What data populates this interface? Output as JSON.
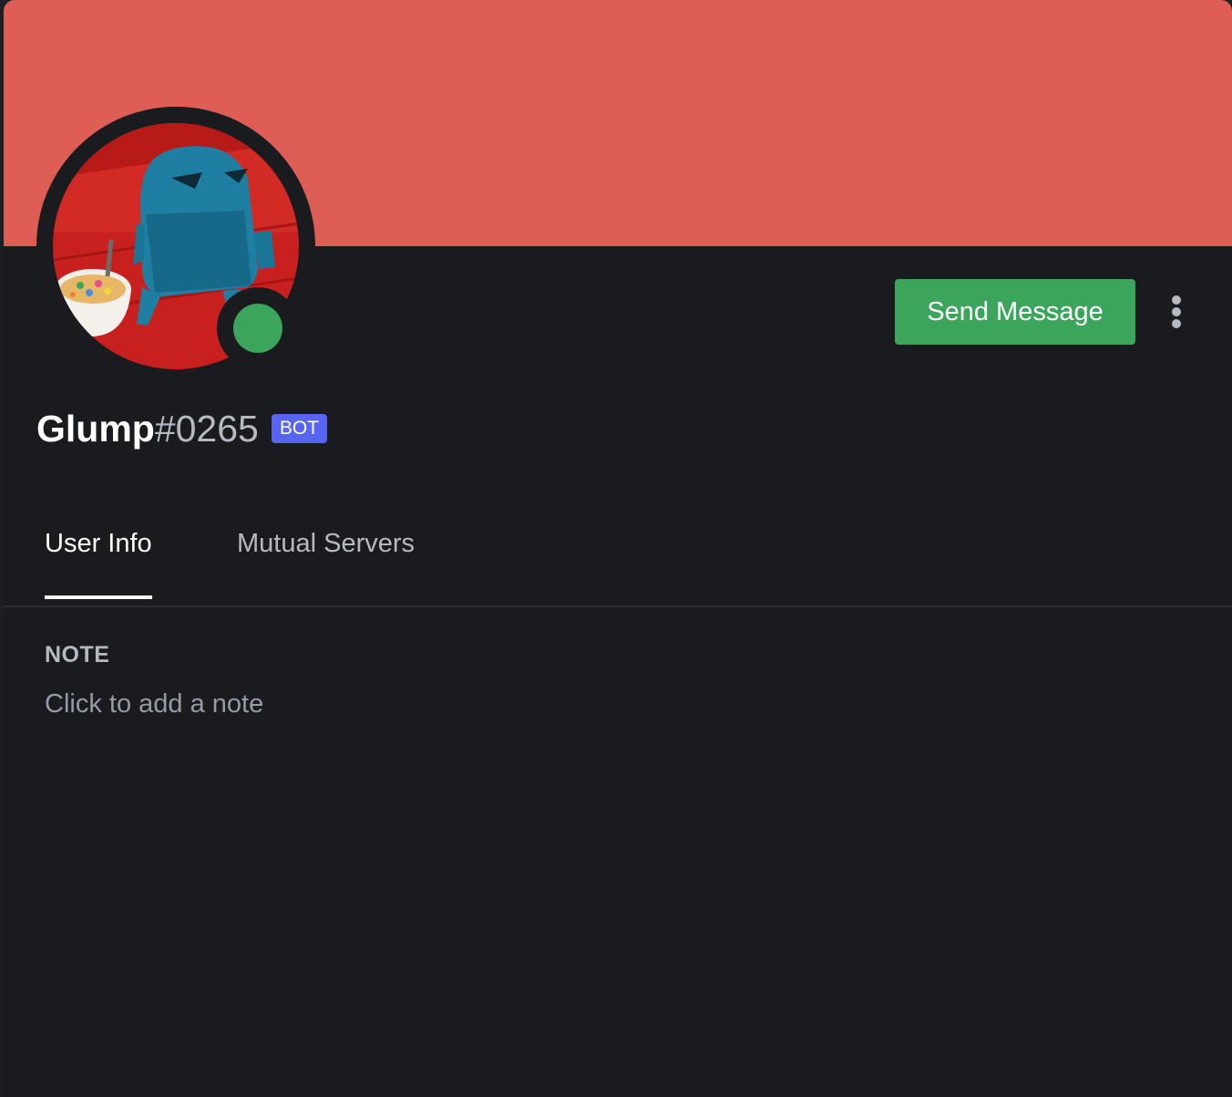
{
  "profile": {
    "username": "Glump",
    "discriminator": "#0265",
    "bot_tag": "BOT",
    "status": "online",
    "banner_color": "#de5e55",
    "status_color": "#3ba55c"
  },
  "actions": {
    "send_message_label": "Send Message",
    "more_icon": "more-vertical-icon"
  },
  "tabs": [
    {
      "label": "User Info",
      "active": true
    },
    {
      "label": "Mutual Servers",
      "active": false
    }
  ],
  "note": {
    "heading": "NOTE",
    "placeholder": "Click to add a note"
  }
}
